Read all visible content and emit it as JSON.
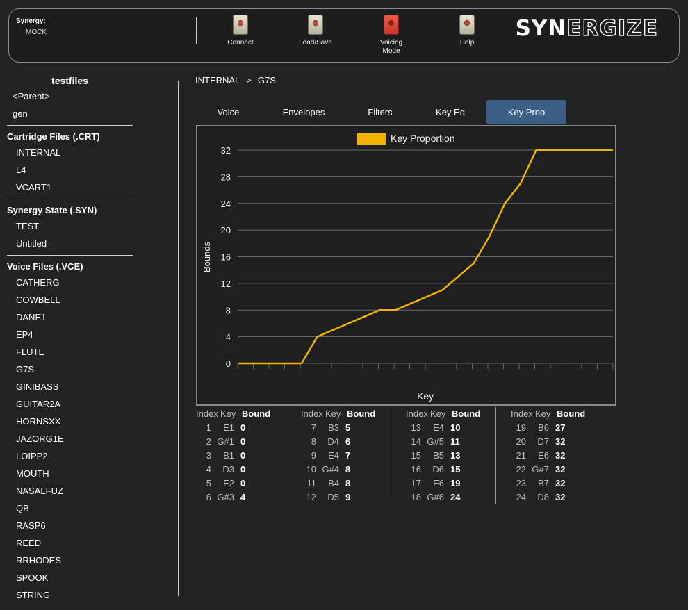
{
  "header": {
    "status_title": "Synergy:",
    "status_value": "MOCK",
    "buttons": [
      {
        "label": "Connect",
        "icon": "switch-icon"
      },
      {
        "label": "Load/Save",
        "icon": "switch-icon"
      },
      {
        "label": "Voicing Mode",
        "icon": "switch-icon-active"
      },
      {
        "label": "Help",
        "icon": "switch-icon"
      }
    ],
    "logo_a": "SYN",
    "logo_b": "ERGIZE"
  },
  "sidebar": {
    "title": "testfiles",
    "top_items": [
      "<Parent>",
      "gen"
    ],
    "sections": [
      {
        "title": "Cartridge Files (.CRT)",
        "items": [
          "INTERNAL",
          "L4",
          "VCART1"
        ]
      },
      {
        "title": "Synergy State (.SYN)",
        "items": [
          "TEST",
          "Untitled"
        ]
      },
      {
        "title": "Voice Files (.VCE)",
        "items": [
          "CATHERG",
          "COWBELL",
          "DANE1",
          "EP4",
          "FLUTE",
          "G7S",
          "GINIBASS",
          "GUITAR2A",
          "HORNSXX",
          "JAZORG1E",
          "LOIPP2",
          "MOUTH",
          "NASALFUZ",
          "QB",
          "RASP6",
          "REED",
          "RRHODES",
          "SPOOK",
          "STRING"
        ]
      }
    ]
  },
  "breadcrumb": {
    "root": "INTERNAL",
    "sep": ">",
    "current": "G7S"
  },
  "tabs": [
    "Voice",
    "Envelopes",
    "Filters",
    "Key Eq",
    "Key Prop"
  ],
  "active_tab": "Key Prop",
  "chart_data": {
    "type": "line",
    "title": "",
    "legend": [
      "Key Proportion"
    ],
    "legend_position": "top",
    "xlabel": "Key",
    "ylabel": "Bounds",
    "ylim": [
      0,
      32
    ],
    "yticks": [
      0,
      4,
      8,
      12,
      16,
      20,
      24,
      28,
      32
    ],
    "grid": true,
    "line_color": "#f0b400",
    "series": [
      {
        "name": "Key Proportion",
        "values": [
          0,
          0,
          0,
          0,
          0,
          4,
          5,
          6,
          7,
          8,
          8,
          9,
          10,
          11,
          13,
          15,
          19,
          24,
          27,
          32,
          32,
          32,
          32,
          32
        ]
      }
    ]
  },
  "table": {
    "headers": [
      "Index",
      "Key",
      "Bound"
    ],
    "rows": [
      [
        1,
        "E1",
        0
      ],
      [
        2,
        "G#1",
        0
      ],
      [
        3,
        "B1",
        0
      ],
      [
        4,
        "D3",
        0
      ],
      [
        5,
        "E2",
        0
      ],
      [
        6,
        "G#3",
        4
      ],
      [
        7,
        "B3",
        5
      ],
      [
        8,
        "D4",
        6
      ],
      [
        9,
        "E4",
        7
      ],
      [
        10,
        "G#4",
        8
      ],
      [
        11,
        "B4",
        8
      ],
      [
        12,
        "D5",
        9
      ],
      [
        13,
        "E4",
        10
      ],
      [
        14,
        "G#5",
        11
      ],
      [
        15,
        "B5",
        13
      ],
      [
        16,
        "D6",
        15
      ],
      [
        17,
        "E6",
        19
      ],
      [
        18,
        "G#6",
        24
      ],
      [
        19,
        "B6",
        27
      ],
      [
        20,
        "D7",
        32
      ],
      [
        21,
        "E6",
        32
      ],
      [
        22,
        "G#7",
        32
      ],
      [
        23,
        "B7",
        32
      ],
      [
        24,
        "D8",
        32
      ]
    ]
  },
  "colors": {
    "accent_tab": "#3a5e86",
    "line": "#f0b400",
    "background": "#222222"
  }
}
